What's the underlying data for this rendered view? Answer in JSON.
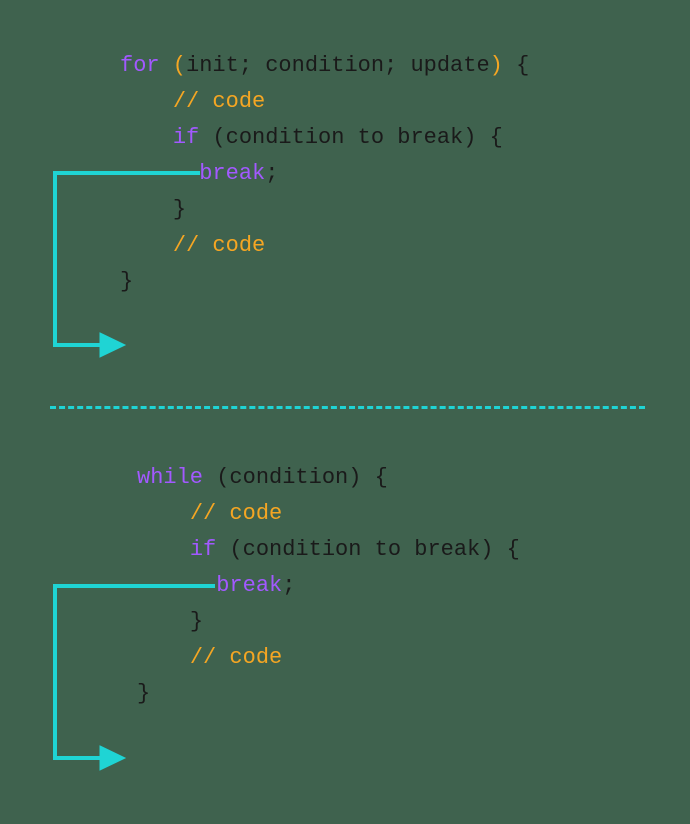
{
  "for_block": {
    "line1": {
      "for": "for",
      "paren_open": " (",
      "args": "init; condition; update",
      "paren_close": ")",
      "brace": " {"
    },
    "line2": "// code",
    "line3": {
      "if": "if",
      "rest": " (condition to break) {"
    },
    "line4": {
      "break": "break",
      "semi": ";"
    },
    "line5": "}",
    "line6": "// code",
    "line7": "}"
  },
  "while_block": {
    "line1": {
      "while": "while",
      "rest": " (condition) {"
    },
    "line2": "// code",
    "line3": {
      "if": "if",
      "rest": " (condition to break) {"
    },
    "line4": {
      "break": "break",
      "semi": ";"
    },
    "line5": "}",
    "line6": "// code",
    "line7": "}"
  }
}
